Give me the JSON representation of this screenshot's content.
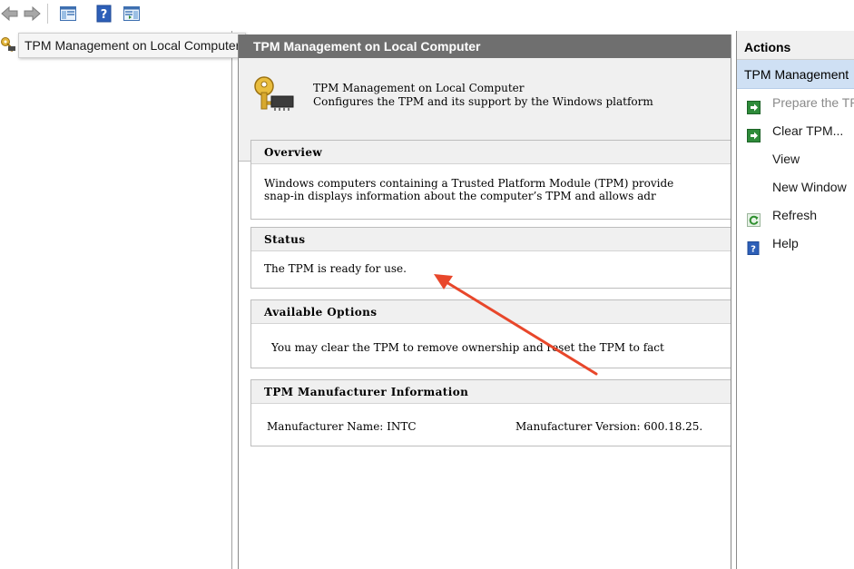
{
  "tree": {
    "item_label": "TPM Management on Local Computer"
  },
  "center": {
    "header_title": "TPM Management on Local Computer",
    "intro_title": "TPM Management on Local Computer",
    "intro_desc": "Configures the TPM and its support by the Windows platform",
    "overview": {
      "heading": "Overview",
      "line1": "Windows computers containing a Trusted Platform Module (TPM) provide",
      "line2": "snap-in displays information about the computer’s TPM and allows adr"
    },
    "status": {
      "heading": "Status",
      "text": "The TPM is ready for use."
    },
    "options": {
      "heading": "Available Options",
      "text": "You may clear the TPM to remove ownership and reset the TPM to fact"
    },
    "manufacturer": {
      "heading": "TPM Manufacturer Information",
      "name": "Manufacturer Name: INTC",
      "version": "Manufacturer Version: 600.18.25."
    }
  },
  "actions": {
    "title": "Actions",
    "subheader": "TPM Management",
    "items": [
      {
        "label": "Prepare the TP",
        "icon": "green-arrow-icon",
        "enabled": false
      },
      {
        "label": "Clear TPM...",
        "icon": "green-arrow-icon",
        "enabled": true
      },
      {
        "label": "View",
        "icon": "",
        "enabled": true
      },
      {
        "label": "New Window",
        "icon": "",
        "enabled": true
      },
      {
        "label": "Refresh",
        "icon": "refresh-icon",
        "enabled": true
      },
      {
        "label": "Help",
        "icon": "help-icon",
        "enabled": true
      }
    ]
  },
  "colors": {
    "header_bg": "#6f6f6f",
    "actions_highlight": "#cfe0f4",
    "annotation_arrow": "#e8472b"
  }
}
